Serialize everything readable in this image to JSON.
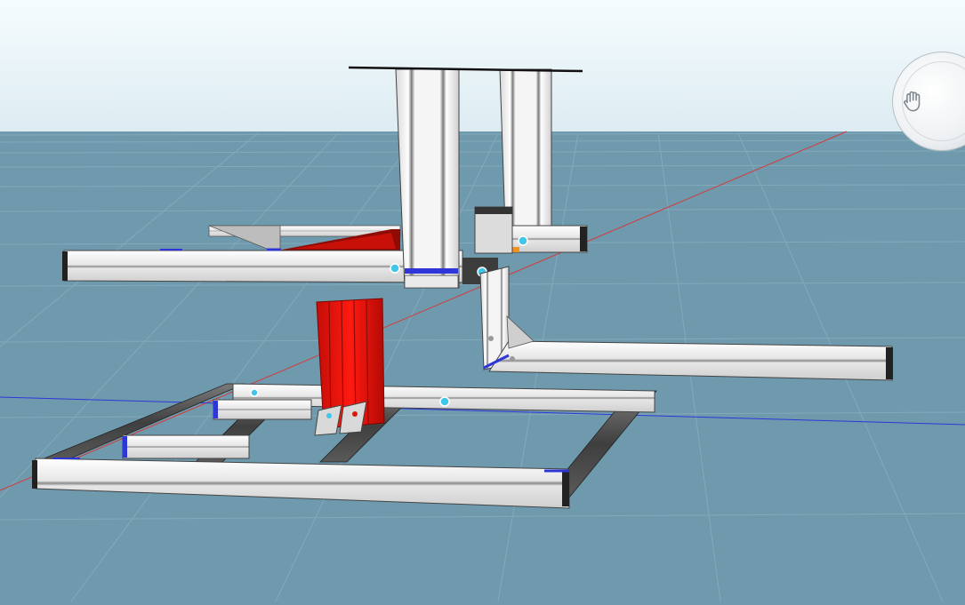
{
  "window": {
    "title": ""
  },
  "colors": {
    "sky_top": "#f4fbfd",
    "sky_bottom": "#dfeef3",
    "ground": "#6f9aae",
    "grid_line": "#85aabb",
    "axis_x": "#d23a3a",
    "axis_y": "#2f36d8",
    "aluminium_light": "#f3f3f3",
    "aluminium_dark": "#555555",
    "part_red": "#e3120b",
    "connector_blue": "#2f36d8",
    "bracket_cyan": "#3fc6e8",
    "orange_marker": "#f2911c"
  },
  "navigation": {
    "view_cube": "view-cube",
    "pan_tool": "pan-hand-icon"
  }
}
